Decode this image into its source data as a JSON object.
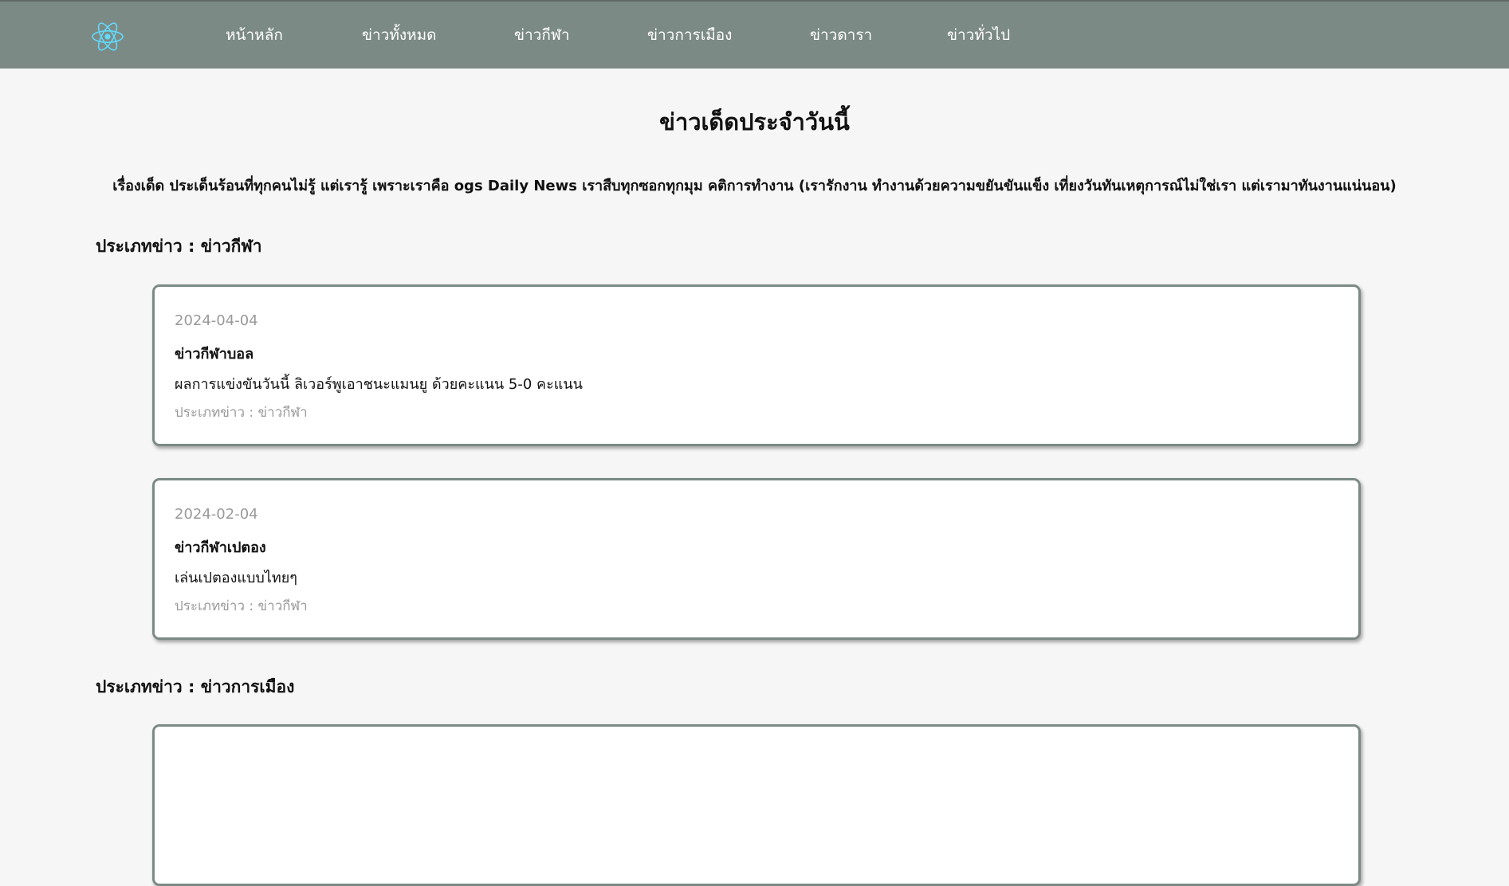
{
  "nav": {
    "logo_icon": "react-atom-icon",
    "logo_color": "#61dafb",
    "background": "#7c8a85",
    "items": [
      {
        "label": "หน้าหลัก"
      },
      {
        "label": "ข่าวทั้งหมด"
      },
      {
        "label": "ข่าวกีฬา"
      },
      {
        "label": "ข่าวการเมือง"
      },
      {
        "label": "ข่าวดารา"
      },
      {
        "label": "ข่าวทั่วไป"
      }
    ]
  },
  "page": {
    "title": "ข่าวเด็ดประจำวันนี้",
    "tagline": "เรื่องเด็ด ประเด็นร้อนที่ทุกคนไม่รู้ แต่เรารู้ เพราะเราคือ ogs Daily News เราสืบทุกซอกทุกมุม คติการทำงาน (เรารักงาน ทำงานด้วยความขยันขันแข็ง เที่ยงวันทันเหตุการณ์ไม่ใช่เรา แต่เรามาทันงานแน่นอน)"
  },
  "sections": [
    {
      "heading": "ประเภทข่าว : ข่าวกีฬา",
      "cards": [
        {
          "date": "2024-04-04",
          "title": "ข่าวกีฬาบอล",
          "body": "ผลการแข่งขันวันนี้ ลิเวอร์พูเอาชนะแมนยู ด้วยคะแนน 5-0 คะแนน",
          "category": "ประเภทข่าว : ข่าวกีฬา"
        },
        {
          "date": "2024-02-04",
          "title": "ข่าวกีฬาเปตอง",
          "body": "เล่นเปตองแบบไทยๆ",
          "category": "ประเภทข่าว : ข่าวกีฬา"
        }
      ]
    },
    {
      "heading": "ประเภทข่าว : ข่าวการเมือง",
      "cards": [
        {
          "date": "",
          "title": "",
          "body": "",
          "category": ""
        }
      ]
    }
  ]
}
